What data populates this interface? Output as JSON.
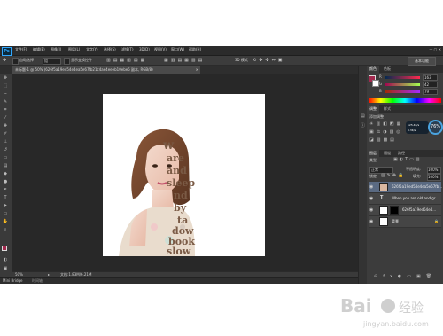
{
  "app": {
    "logo": "Ps",
    "menu": [
      "文件(F)",
      "编辑(E)",
      "图像(I)",
      "图层(L)",
      "文字(Y)",
      "选择(S)",
      "滤镜(T)",
      "3D(D)",
      "视图(V)",
      "窗口(W)",
      "帮助(H)"
    ],
    "window_controls": "— ▢ ✕"
  },
  "options_bar": {
    "auto_select_label": "自动选择",
    "auto_select_value": "组",
    "show_transform_label": "显示变换控件",
    "mode_3d_label": "3D 模式",
    "workspace_button": "基本功能"
  },
  "document_tab": {
    "title": "未标题-1 @ 50% (626f5a19ed54e4ea5e67fb21c4ae4eeeb10ebe5 副本, RGB/8)"
  },
  "canvas_art": {
    "collage_text": [
      "w",
      "are",
      "and",
      "sleep",
      "nd",
      "by",
      "ta",
      "dow",
      "book",
      "slow"
    ]
  },
  "status_bar": {
    "zoom": "50%",
    "doc_size": "文档:1.83M/6.21M",
    "mini_bridge_tab": "Mini Bridge",
    "timeline_tab": "时间轴"
  },
  "color_panel": {
    "tabs": [
      "颜色",
      "色板"
    ],
    "r": "163",
    "g": "42",
    "b": "79",
    "r_label": "R",
    "g_label": "G",
    "b_label": "B",
    "foreground_color": "#a32a4f"
  },
  "adjustments_panel": {
    "tabs": [
      "调整",
      "样式"
    ],
    "add_label": "添加调整"
  },
  "perf_badge": {
    "percent": "76%",
    "up_speed": "125.4K/s",
    "down_speed": "0.3K/s"
  },
  "layers_panel": {
    "tabs": [
      "图层",
      "通道",
      "路径"
    ],
    "kind_label": "类型",
    "blend_mode": "正常",
    "opacity_label": "不透明度:",
    "opacity_value": "100%",
    "lock_label": "锁定:",
    "fill_label": "填充:",
    "fill_value": "100%",
    "layers": [
      {
        "name": "626f5a19ed54e4ea5e67fb..."
      },
      {
        "name": "When you are old and gr..."
      },
      {
        "name": "626f5a19ed54e4..."
      },
      {
        "name": "背景"
      }
    ]
  },
  "watermark": {
    "brand": "Bai",
    "brand_cn": "经验",
    "url": "jingyan.baidu.com"
  }
}
